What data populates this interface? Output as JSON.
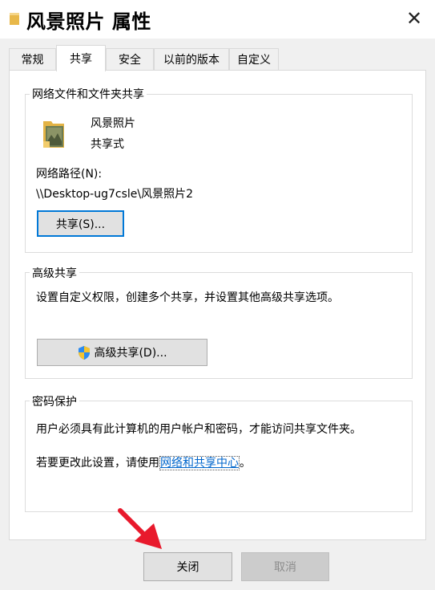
{
  "window": {
    "title": "风景照片 属性",
    "close_glyph": "✕"
  },
  "tabs": [
    {
      "label": "常规"
    },
    {
      "label": "共享"
    },
    {
      "label": "安全"
    },
    {
      "label": "以前的版本"
    },
    {
      "label": "自定义"
    }
  ],
  "network_sharing": {
    "group_title": "网络文件和文件夹共享",
    "folder_name": "风景照片",
    "share_status": "共享式",
    "path_label": "网络路径(N):",
    "path_value": "\\\\Desktop-ug7csle\\风景照片2",
    "share_button": "共享(S)..."
  },
  "advanced_sharing": {
    "group_title": "高级共享",
    "description": "设置自定义权限，创建多个共享，并设置其他高级共享选项。",
    "button": "高级共享(D)..."
  },
  "password_protection": {
    "group_title": "密码保护",
    "description": "用户必须具有此计算机的用户帐户和密码，才能访问共享文件夹。",
    "change_prefix": "若要更改此设置，请使用",
    "link_text": "网络和共享中心",
    "change_suffix": "。"
  },
  "footer": {
    "close_button": "关闭",
    "cancel_button": "取消"
  },
  "colors": {
    "accent": "#0078d7",
    "link": "#0066cc",
    "arrow": "#e8192c"
  }
}
